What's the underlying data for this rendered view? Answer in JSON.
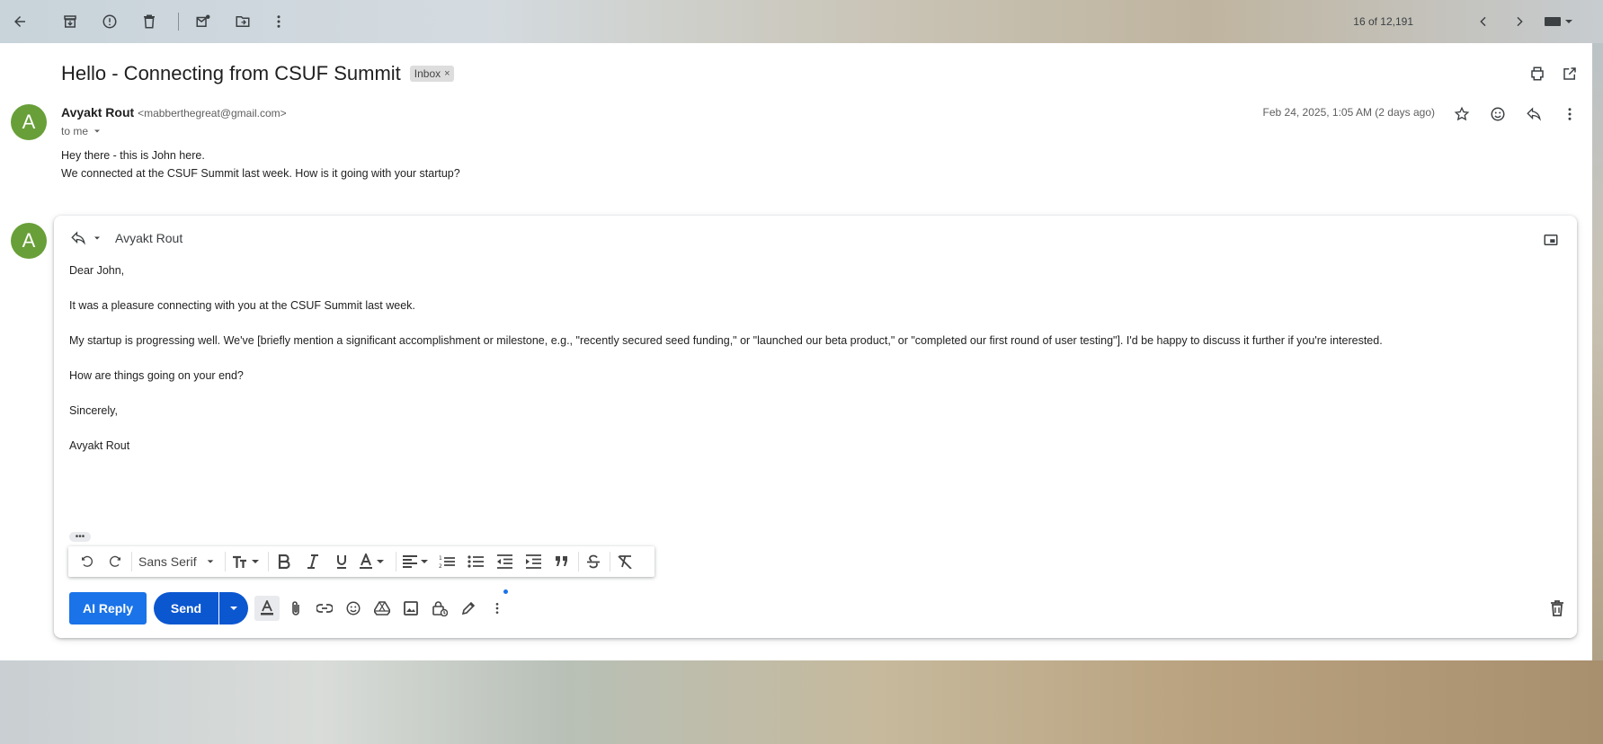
{
  "toolbar": {
    "counter": "16 of 12,191"
  },
  "email": {
    "subject": "Hello - Connecting from CSUF Summit",
    "label": "Inbox",
    "label_remove": "×",
    "sender_name": "Avyakt Rout",
    "sender_email": "<mabberthegreat@gmail.com>",
    "to": "to me",
    "date": "Feb 24, 2025, 1:05 AM (2 days ago)",
    "avatar_letter": "A",
    "body": [
      "Hey there - this is John here.",
      "We connected at the CSUF Summit last week. How is it going with your startup?"
    ]
  },
  "composer": {
    "avatar_letter": "A",
    "recipient": "Avyakt Rout",
    "lines": [
      "Dear John,",
      "It was a pleasure connecting with you at the CSUF Summit last week.",
      "My startup is progressing well. We've [briefly mention a significant accomplishment or milestone, e.g., \"recently secured seed funding,\" or \"launched our beta product,\" or \"completed our first round of user testing\"]. I'd be happy to discuss it further if you're interested.",
      "How are things going on your end?",
      "Sincerely,",
      "Avyakt Rout"
    ],
    "ellipsis": "•••",
    "font": "Sans Serif",
    "ai_reply": "AI Reply",
    "send": "Send"
  },
  "colors": {
    "avatar": "#689f38",
    "send": "#0b57d0",
    "ai_reply": "#1a73e8"
  }
}
